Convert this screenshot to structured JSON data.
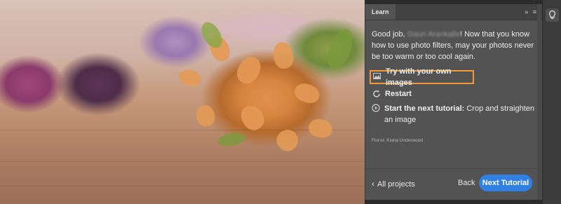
{
  "panel": {
    "tab_label": "Learn",
    "header_icons": "» ≡",
    "message_prefix": "Good job,",
    "user_name": "Gauri Arankalle",
    "message_suffix": "! Now that you know how to use photo filters, may your photos never be too warm or too cool again.",
    "options": {
      "try_own_images": "Try with your own images",
      "restart": "Restart"
    },
    "next_tutorial_label": "Start the next tutorial:",
    "next_tutorial_title": "Crop and straighten an image",
    "credit": "Florist: Kiana Underwood"
  },
  "footer": {
    "all_projects": "All projects",
    "back": "Back",
    "next_tutorial": "Next Tutorial"
  },
  "colors": {
    "accent_blue": "#2f80e2",
    "highlight_orange": "#f29a37"
  },
  "icons": {
    "image": "image-icon",
    "restart": "restart-icon",
    "play": "play-circle-icon",
    "chevron_left": "chevron-left-icon",
    "lightbulb": "lightbulb-icon"
  }
}
